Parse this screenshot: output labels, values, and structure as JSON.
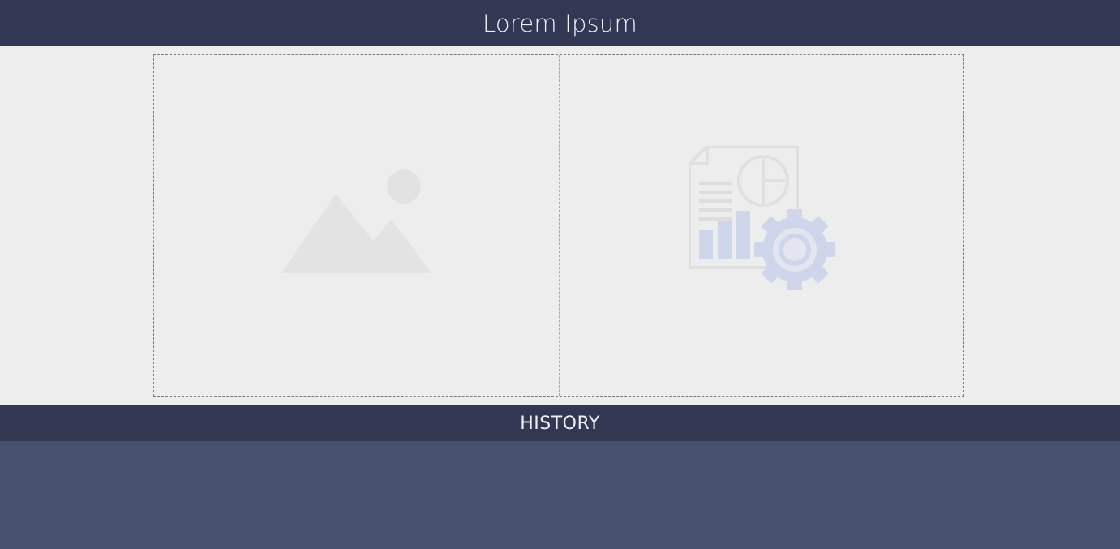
{
  "header": {
    "title": "Lorem Ipsum"
  },
  "main": {
    "left_panel": {
      "icon": "image-placeholder-icon"
    },
    "right_panel": {
      "icon": "report-settings-icon"
    }
  },
  "history": {
    "label": "HISTORY"
  },
  "colors": {
    "header_bg": "#323753",
    "content_bg": "#ededed",
    "history_area_bg": "#485170",
    "accent_icon": "#cfd5ea"
  }
}
